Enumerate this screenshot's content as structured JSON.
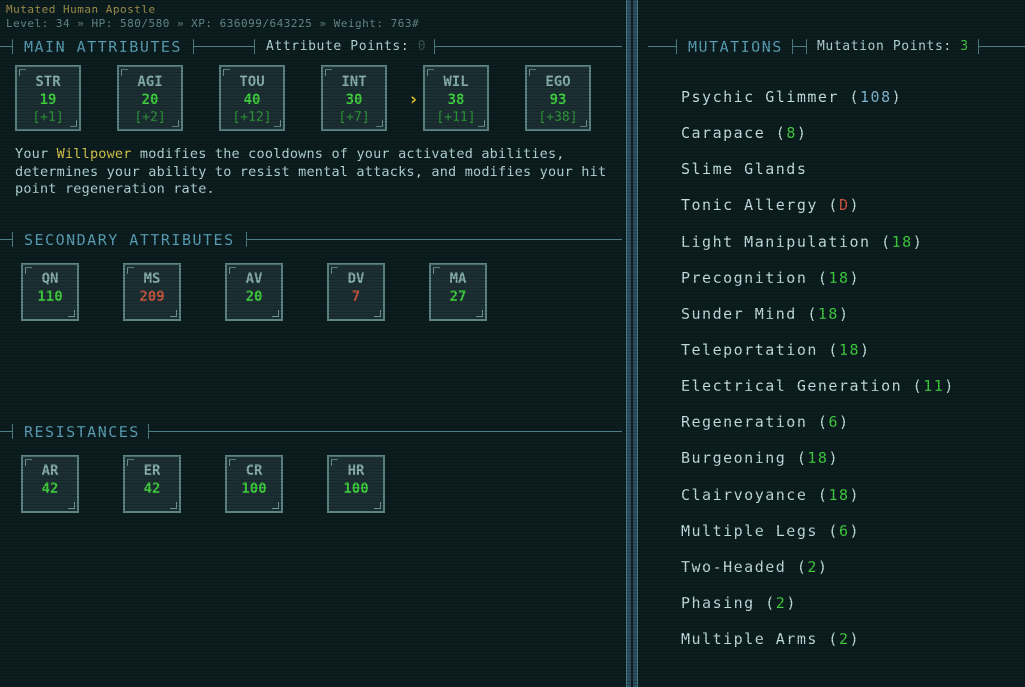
{
  "character": {
    "name": "Mutated Human Apostle",
    "stats_line": "Level: 34 » HP: 580/580 » XP: 636099/643225 » Weight: 763#"
  },
  "main_attributes": {
    "title": "MAIN ATTRIBUTES",
    "points_label": "Attribute Points:",
    "points_value": "0",
    "items": [
      {
        "label": "STR",
        "value": "19",
        "mod": "[+1]"
      },
      {
        "label": "AGI",
        "value": "20",
        "mod": "[+2]"
      },
      {
        "label": "TOU",
        "value": "40",
        "mod": "[+12]"
      },
      {
        "label": "INT",
        "value": "30",
        "mod": "[+7]"
      },
      {
        "label": "WIL",
        "value": "38",
        "mod": "[+11]"
      },
      {
        "label": "EGO",
        "value": "93",
        "mod": "[+38]"
      }
    ],
    "selected": "WIL"
  },
  "description": {
    "before": "Your ",
    "highlight": "Willpower",
    "after": " modifies the cooldowns of your activated abilities, determines your ability to resist mental attacks, and modifies your hit point regeneration rate."
  },
  "secondary_attributes": {
    "title": "SECONDARY ATTRIBUTES",
    "items": [
      {
        "label": "QN",
        "value": "110",
        "color": "green"
      },
      {
        "label": "MS",
        "value": "209",
        "color": "red"
      },
      {
        "label": "AV",
        "value": "20",
        "color": "green"
      },
      {
        "label": "DV",
        "value": "7",
        "color": "red"
      },
      {
        "label": "MA",
        "value": "27",
        "color": "green"
      }
    ]
  },
  "resistances": {
    "title": "RESISTANCES",
    "items": [
      {
        "label": "AR",
        "value": "42"
      },
      {
        "label": "ER",
        "value": "42"
      },
      {
        "label": "CR",
        "value": "100"
      },
      {
        "label": "HR",
        "value": "100"
      }
    ]
  },
  "mutations": {
    "title": "MUTATIONS",
    "points_label": "Mutation Points:",
    "points_value": "3",
    "items": [
      {
        "name": "Psychic Glimmer",
        "level": "108",
        "color": "blue"
      },
      {
        "name": "Carapace",
        "level": "8",
        "color": "green"
      },
      {
        "name": "Slime Glands",
        "level": "",
        "color": "green"
      },
      {
        "name": "Tonic Allergy",
        "level": "D",
        "color": "red"
      },
      {
        "name": "Light Manipulation",
        "level": "18",
        "color": "green"
      },
      {
        "name": "Precognition",
        "level": "18",
        "color": "green"
      },
      {
        "name": "Sunder Mind",
        "level": "18",
        "color": "green"
      },
      {
        "name": "Teleportation",
        "level": "18",
        "color": "green"
      },
      {
        "name": "Electrical Generation",
        "level": "11",
        "color": "green"
      },
      {
        "name": "Regeneration",
        "level": "6",
        "color": "green"
      },
      {
        "name": "Burgeoning",
        "level": "18",
        "color": "green"
      },
      {
        "name": "Clairvoyance",
        "level": "18",
        "color": "green"
      },
      {
        "name": "Multiple Legs",
        "level": "6",
        "color": "green"
      },
      {
        "name": "Two-Headed",
        "level": "2",
        "color": "green"
      },
      {
        "name": "Phasing",
        "level": "2",
        "color": "green"
      },
      {
        "name": "Multiple Arms",
        "level": "2",
        "color": "green"
      }
    ]
  },
  "colors": {
    "background": "#0c1d20",
    "section_title": "#5aa0b6",
    "value_green": "#3fcf3f",
    "value_red": "#c8563e",
    "highlight_yellow": "#d8c84a"
  }
}
